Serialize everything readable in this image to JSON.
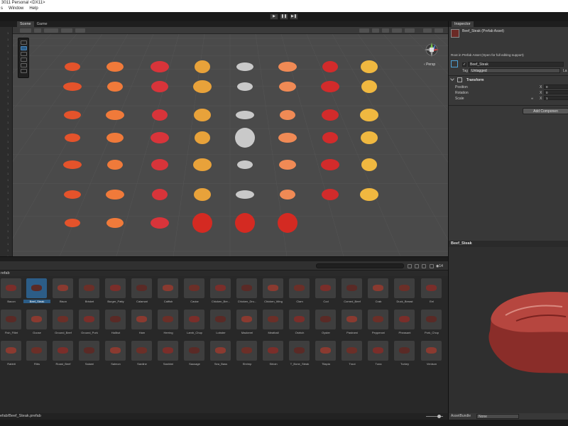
{
  "window": {
    "title": "3011 Personal <DX11>"
  },
  "menu": [
    "s",
    "Window",
    "Help"
  ],
  "tabs": {
    "scene": "Scene",
    "game": "Game",
    "inspector": "Inspector"
  },
  "scene": {
    "view_mode": "Persp"
  },
  "breadcrumb": "refab",
  "project": {
    "item_count": "14"
  },
  "assets": [
    {
      "label": "Bacon"
    },
    {
      "label": "Beef_Steak"
    },
    {
      "label": "Bison"
    },
    {
      "label": "Brisket"
    },
    {
      "label": "Burger_Patty"
    },
    {
      "label": "Calamari"
    },
    {
      "label": "Catfish"
    },
    {
      "label": "Caviar"
    },
    {
      "label": "Chicken_Bre..."
    },
    {
      "label": "Chicken_Dru..."
    },
    {
      "label": "Chicken_Wing"
    },
    {
      "label": "Clam"
    },
    {
      "label": "Cod"
    },
    {
      "label": "Corned_Beef"
    },
    {
      "label": "Crab"
    },
    {
      "label": "Duck_Breast"
    },
    {
      "label": "Eel"
    },
    {
      "label": "Fish_Fillet"
    },
    {
      "label": "Goose"
    },
    {
      "label": "Ground_Beef"
    },
    {
      "label": "Ground_Pork"
    },
    {
      "label": "Halibut"
    },
    {
      "label": "Ham"
    },
    {
      "label": "Herring"
    },
    {
      "label": "Lamb_Chop"
    },
    {
      "label": "Lobster"
    },
    {
      "label": "Mackerel"
    },
    {
      "label": "Meatball"
    },
    {
      "label": "Ostrich"
    },
    {
      "label": "Oyster"
    },
    {
      "label": "Pastrami"
    },
    {
      "label": "Pepperoni"
    },
    {
      "label": "Pheasant"
    },
    {
      "label": "Pork_Chop"
    },
    {
      "label": "Rabbit"
    },
    {
      "label": "Ribs"
    },
    {
      "label": "Roast_Beef"
    },
    {
      "label": "Salami"
    },
    {
      "label": "Salmon"
    },
    {
      "label": "Sardine"
    },
    {
      "label": "Sashimi"
    },
    {
      "label": "Sausage"
    },
    {
      "label": "Sea_Bass"
    },
    {
      "label": "Shrimp"
    },
    {
      "label": "Sirloin"
    },
    {
      "label": "T_Bone_Steak"
    },
    {
      "label": "Tilapia"
    },
    {
      "label": "Trout"
    },
    {
      "label": "Tuna"
    },
    {
      "label": "Turkey"
    },
    {
      "label": "Venison"
    }
  ],
  "footer_path": "efab/Beef_Steak.prefab",
  "inspector": {
    "asset_name": "Beef_Steak (Prefab Asset)",
    "root_note": "Root in Prefab Asset (Open for full editing support)",
    "object_name": "Beef_Steak",
    "tag_label": "Tag",
    "tag_value": "Untagged",
    "layer_label": "La",
    "component": "Transform",
    "position_label": "Position",
    "rotation_label": "Rotation",
    "scale_label": "Scale",
    "x_label": "X",
    "position_x": "0",
    "rotation_x": "0",
    "scale_x": "1",
    "add_component": "Add Componen"
  },
  "preview": {
    "title": "Beef_Steak"
  },
  "asset_bundle": {
    "label": "AssetBundle",
    "value": "None"
  },
  "food_colors": [
    "#e4532b",
    "#f07a3a",
    "#d8343a",
    "#e8a23a",
    "#c9c9c9",
    "#f08a55",
    "#d22b2b",
    "#f0b840"
  ]
}
